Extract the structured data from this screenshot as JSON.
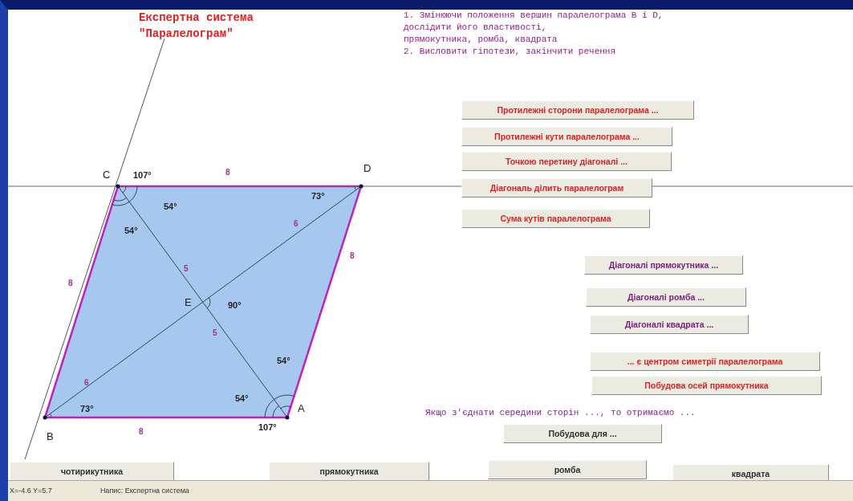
{
  "title": [
    "Експертна система",
    "\"Паралелограм\""
  ],
  "task_lines": [
    "1. Змінюючи положення вершин паралелограма B i D,",
    "дослідити його властивості,",
    "прямокутника, ромба, квадрата",
    "2. Висловити гіпотези, закінчити речення"
  ],
  "points": [
    {
      "name": "C"
    },
    {
      "name": "D"
    },
    {
      "name": "E"
    },
    {
      "name": "A"
    },
    {
      "name": "B"
    }
  ],
  "angle_labels": [
    "107°",
    "54°",
    "54°",
    "73°",
    "90°",
    "54°",
    "54°",
    "73°",
    "107°"
  ],
  "length_labels": [
    "8",
    "6",
    "8",
    "8",
    "5",
    "5",
    "6",
    "8"
  ],
  "buttons": [
    {
      "label": "Протилежні сторони паралелограма ...",
      "color": "#e02020"
    },
    {
      "label": "Протилежні кути паралелограма ...",
      "color": "#e02020"
    },
    {
      "label": "Точкою перетину діагоналі ...",
      "color": "#e02020"
    },
    {
      "label": "Діагональ ділить паралелограм",
      "color": "#e02020"
    },
    {
      "label": "Сума кутів паралелограма",
      "color": "#e02020"
    },
    {
      "label": "Діагоналі прямокутника ...",
      "color": "#802080"
    },
    {
      "label": "Діагоналі ромба ...",
      "color": "#802080"
    },
    {
      "label": "Діагоналі квадрата ...",
      "color": "#802080"
    },
    {
      "label": "... є центром симетрії паралелограма",
      "color": "#e02020"
    },
    {
      "label": "Побудова осей прямокутника",
      "color": "#e02020"
    },
    {
      "label": "Побудова для ...",
      "color": "#303030"
    },
    {
      "label": "чотирикутника",
      "color": "#303030"
    },
    {
      "label": "прямокутника",
      "color": "#303030"
    },
    {
      "label": "ромба",
      "color": "#303030"
    },
    {
      "label": "квадрата",
      "color": "#303030"
    }
  ],
  "statement": "Якщо з'єднати середини сторін ..., то отримаємо ...",
  "status_bar": {
    "coords": "X=-4.6 Y=5.7",
    "caption": "Напис: Експертна система"
  }
}
